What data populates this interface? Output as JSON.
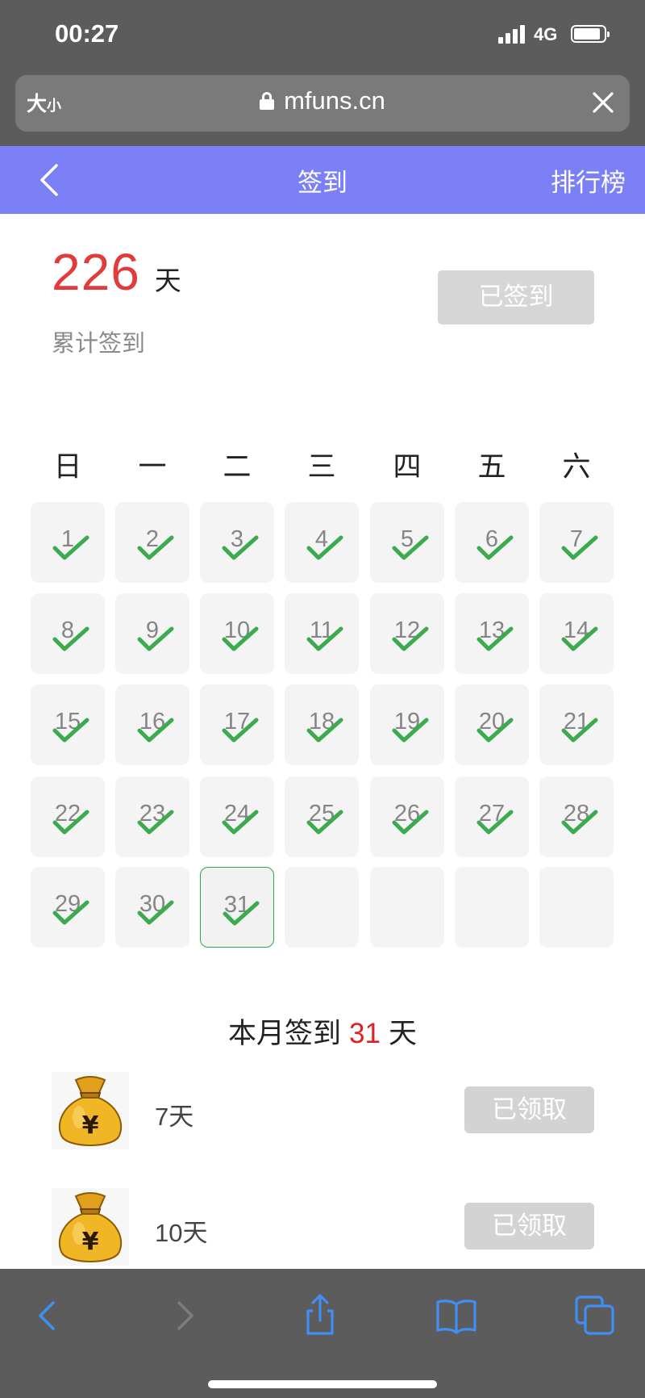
{
  "status_bar": {
    "time": "00:27",
    "network": "4G"
  },
  "url_bar": {
    "text_size_big": "大",
    "text_size_small": "小",
    "domain": "mfuns.cn"
  },
  "header": {
    "title": "签到",
    "rank_link": "排行榜"
  },
  "summary": {
    "total_days": "226",
    "unit": "天",
    "caption": "累计签到",
    "signed_button": "已签到"
  },
  "calendar": {
    "weekdays": [
      "日",
      "一",
      "二",
      "三",
      "四",
      "五",
      "六"
    ],
    "days": [
      "1",
      "2",
      "3",
      "4",
      "5",
      "6",
      "7",
      "8",
      "9",
      "10",
      "11",
      "12",
      "13",
      "14",
      "15",
      "16",
      "17",
      "18",
      "19",
      "20",
      "21",
      "22",
      "23",
      "24",
      "25",
      "26",
      "27",
      "28",
      "29",
      "30",
      "31"
    ],
    "today": "31",
    "check_color": "#3caa4e"
  },
  "month": {
    "prefix": "本月签到",
    "count": "31",
    "suffix": "天"
  },
  "rewards": [
    {
      "days": "7天",
      "button": "已领取",
      "icon": "money-bag-icon"
    },
    {
      "days": "10天",
      "button": "已领取",
      "icon": "money-bag-icon"
    }
  ],
  "colors": {
    "header": "#7b80f7",
    "accent_red": "#e23b3b",
    "browser_chrome": "#5c5c5c",
    "toolbar_icon": "#3f8ff5"
  }
}
